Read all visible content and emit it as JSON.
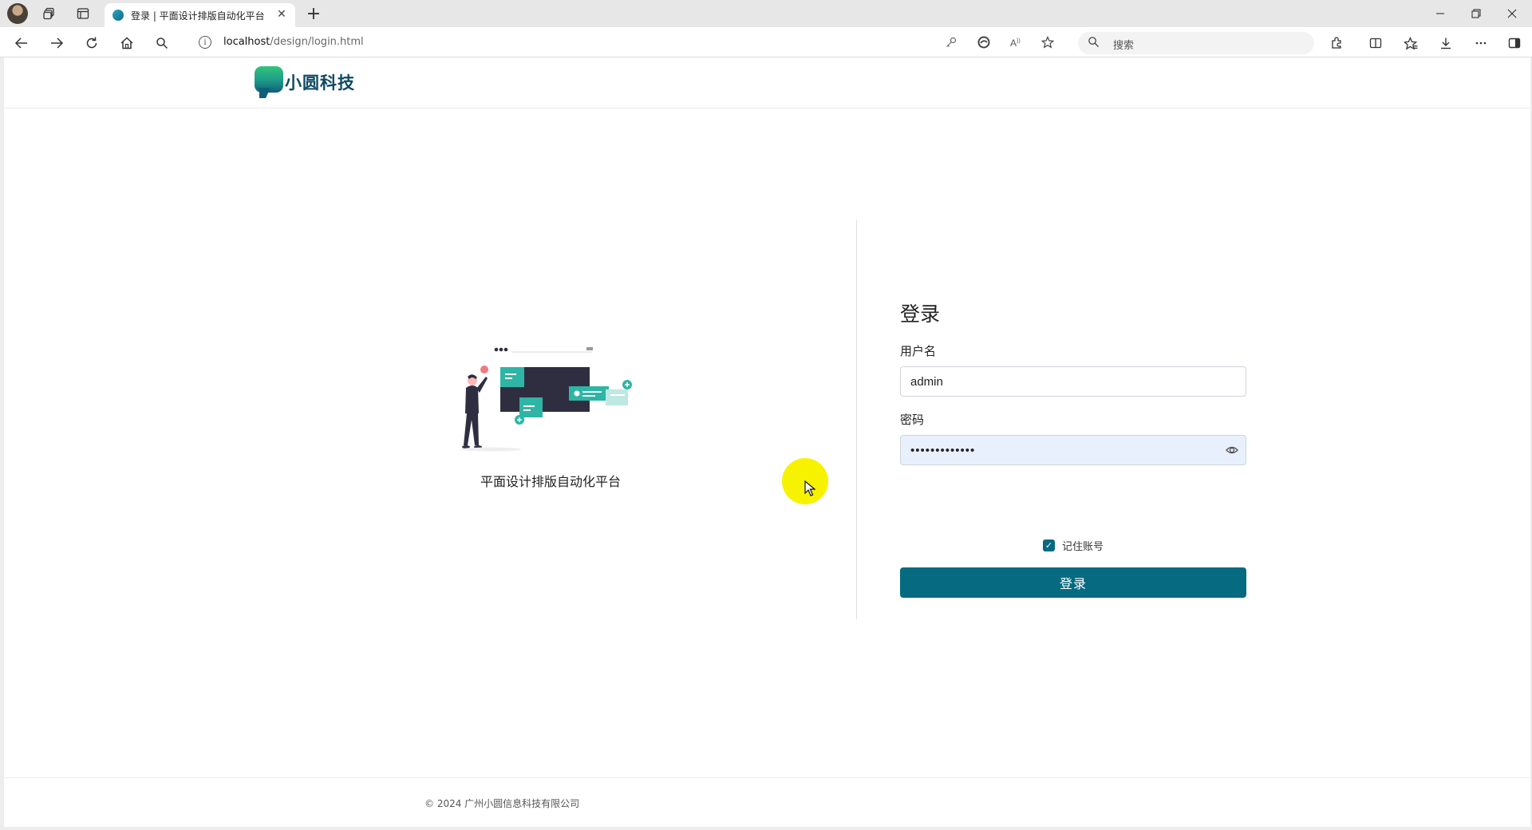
{
  "browser": {
    "tab_title": "登录 | 平面设计排版自动化平台",
    "tab_close_icon": "close-icon",
    "new_tab_icon": "plus-icon",
    "url_host": "localhost",
    "url_path": "/design/login.html",
    "search_placeholder": "搜索",
    "window_controls": [
      "minimize-icon",
      "restore-icon",
      "close-icon"
    ],
    "nav_icons": [
      "back-arrow-icon",
      "forward-arrow-icon",
      "refresh-icon",
      "home-icon",
      "search-icon"
    ],
    "toolbar_icons": [
      "extensions-icon",
      "split-screen-icon",
      "favorites-icon",
      "download-icon",
      "more-icon",
      "sidebar-icon"
    ]
  },
  "header": {
    "logo_text": "小圆科技"
  },
  "illustration": {
    "caption": "平面设计排版自动化平台"
  },
  "login": {
    "title": "登录",
    "username_label": "用户名",
    "username_value": "admin",
    "password_label": "密码",
    "password_value": "•••••••••••••",
    "remember_label": "记住账号",
    "remember_checked": true,
    "submit_label": "登录"
  },
  "footer": {
    "copyright": "© 2024 广州小圆信息科技有限公司"
  },
  "colors": {
    "primary": "#066a80",
    "logo_green": "#33c47a",
    "cursor_highlight": "#f7f200",
    "autofill_bg": "#e8f0fe"
  }
}
